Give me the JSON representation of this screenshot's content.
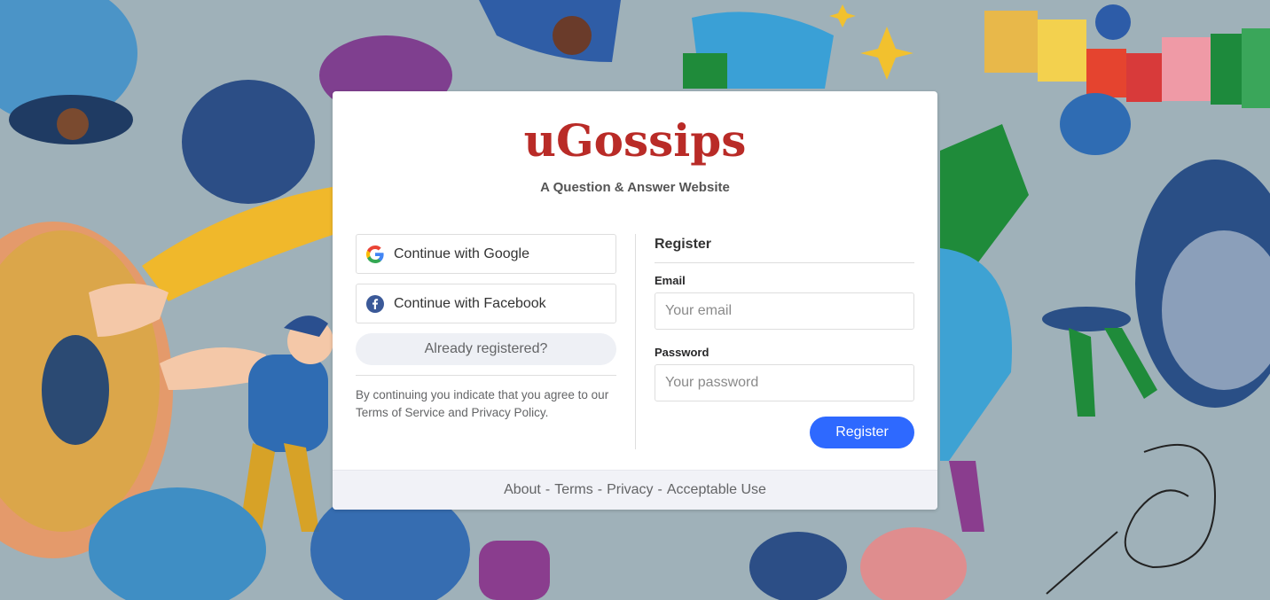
{
  "brand": {
    "logo_text": "uGossips",
    "tagline": "A Question & Answer Website",
    "logo_color": "#b92b27"
  },
  "social": {
    "google_label": "Continue with Google",
    "google_icon": "google-icon",
    "facebook_label": "Continue with Facebook",
    "facebook_icon": "facebook-icon",
    "already_registered": "Already registered?"
  },
  "terms_notice": "By continuing you indicate that you agree to our Terms of Service and Privacy Policy.",
  "register": {
    "title": "Register",
    "email_label": "Email",
    "email_placeholder": "Your email",
    "email_value": "",
    "password_label": "Password",
    "password_placeholder": "Your password",
    "password_value": "",
    "submit_label": "Register",
    "accent_color": "#2e69ff"
  },
  "footer": {
    "links": [
      "About",
      "Terms",
      "Privacy",
      "Acceptable Use"
    ],
    "separator": "-"
  }
}
